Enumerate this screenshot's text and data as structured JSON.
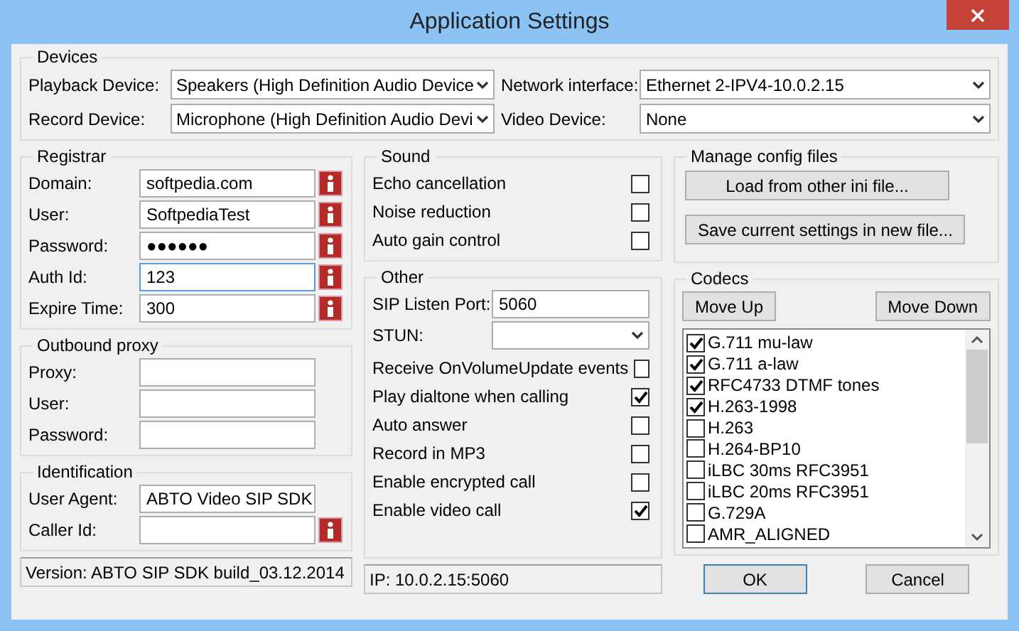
{
  "window": {
    "title": "Application Settings"
  },
  "devices": {
    "title": "Devices",
    "fields": [
      {
        "label": "Playback Device:",
        "value": "Speakers (High Definition Audio Device"
      },
      {
        "label": "Network interface:",
        "value": "Ethernet 2-IPV4-10.0.2.15"
      },
      {
        "label": "Record Device:",
        "value": "Microphone (High Definition Audio Devi"
      },
      {
        "label": "Video Device:",
        "value": "None"
      }
    ]
  },
  "registrar": {
    "title": "Registrar",
    "fields": [
      {
        "label": "Domain:",
        "value": "softpedia.com",
        "focused": false,
        "info": true
      },
      {
        "label": "User:",
        "value": "SoftpediaTest",
        "focused": false,
        "info": true
      },
      {
        "label": "Password:",
        "value": "●●●●●●",
        "focused": false,
        "info": true
      },
      {
        "label": "Auth Id:",
        "value": "123",
        "focused": true,
        "info": true
      },
      {
        "label": "Expire Time:",
        "value": "300",
        "focused": false,
        "info": true
      }
    ]
  },
  "outbound_proxy": {
    "title": "Outbound proxy",
    "fields": [
      {
        "label": "Proxy:",
        "focused": false,
        "info": false
      },
      {
        "label": "User:",
        "focused": false,
        "info": false
      },
      {
        "label": "Password:",
        "focused": false,
        "info": false
      }
    ]
  },
  "identification": {
    "title": "Identification",
    "fields": [
      {
        "label": "User Agent:",
        "value": "ABTO Video SIP SDK",
        "focused": false,
        "info": false
      },
      {
        "label": "Caller Id:",
        "focused": false,
        "info": true
      }
    ]
  },
  "sound": {
    "title": "Sound",
    "options": [
      {
        "label": "Echo cancellation",
        "checked": false
      },
      {
        "label": "Noise reduction",
        "checked": false
      },
      {
        "label": "Auto gain control",
        "checked": false
      }
    ]
  },
  "other": {
    "title": "Other",
    "sip_listen_port": {
      "label": "SIP Listen Port:",
      "value": "5060"
    },
    "stun": {
      "label": "STUN:"
    },
    "options": [
      {
        "label": "Receive OnVolumeUpdate events",
        "checked": false
      },
      {
        "label": "Play dialtone when calling",
        "checked": true
      },
      {
        "label": "Auto answer",
        "checked": false
      },
      {
        "label": "Record in MP3",
        "checked": false
      },
      {
        "label": "Enable encrypted call",
        "checked": false
      },
      {
        "label": "Enable video call",
        "checked": true
      }
    ]
  },
  "manage_config": {
    "title": "Manage config files",
    "buttons": [
      "Load from other ini file...",
      "Save current settings in new file..."
    ]
  },
  "codecs": {
    "title": "Codecs",
    "move_up": "Move Up",
    "move_down": "Move Down",
    "items": [
      {
        "label": "G.711 mu-law",
        "checked": true
      },
      {
        "label": "G.711 a-law",
        "checked": true
      },
      {
        "label": "RFC4733 DTMF tones",
        "checked": true
      },
      {
        "label": "H.263-1998",
        "checked": true
      },
      {
        "label": "H.263",
        "checked": false
      },
      {
        "label": "H.264-BP10",
        "checked": false
      },
      {
        "label": "iLBC 30ms RFC3951",
        "checked": false
      },
      {
        "label": "iLBC 20ms RFC3951",
        "checked": false
      },
      {
        "label": "G.729A",
        "checked": false
      },
      {
        "label": "AMR_ALIGNED",
        "checked": false
      }
    ]
  },
  "status": {
    "version": "Version: ABTO SIP SDK build_03.12.2014",
    "ip": "IP: 10.0.2.15:5060"
  },
  "buttons": {
    "ok": "OK",
    "cancel": "Cancel"
  }
}
